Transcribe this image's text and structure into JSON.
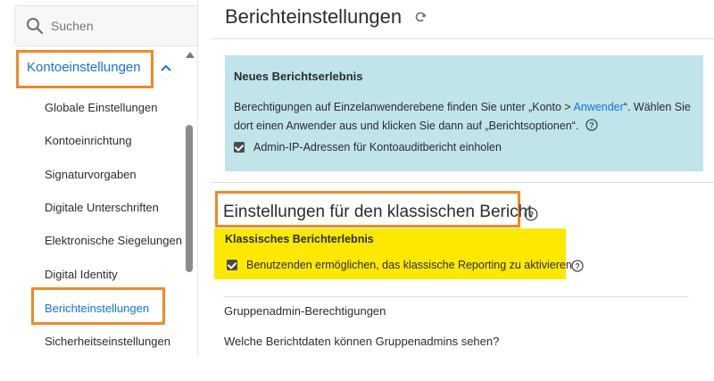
{
  "sidebar": {
    "search_placeholder": "Suchen",
    "group_label": "Kontoeinstellungen",
    "items": [
      {
        "label": "Globale Einstellungen"
      },
      {
        "label": "Kontoeinrichtung"
      },
      {
        "label": "Signaturvorgaben"
      },
      {
        "label": "Digitale Unterschriften"
      },
      {
        "label": "Elektronische Siegelungen"
      },
      {
        "label": "Digital Identity"
      },
      {
        "label": "Berichteinstellungen"
      },
      {
        "label": "Sicherheitseinstellungen"
      }
    ]
  },
  "main": {
    "title": "Berichteinstellungen",
    "info": {
      "title": "Neues Berichtserlebnis",
      "text_part1": "Berechtigungen auf Einzelanwenderebene finden Sie unter „Konto > ",
      "link": "Anwender",
      "text_part2": "“. Wählen Sie dort einen Anwender aus und klicken Sie dann auf „Berichtsoptionen“.",
      "checkbox_label": "Admin-IP-Adressen für Kontoauditbericht einholen"
    },
    "classic": {
      "title": "Einstellungen für den klassischen Bericht",
      "label": "Klassisches Berichterlebnis",
      "checkbox_label": "Benutzenden ermöglichen, das klassische Reporting zu aktivieren"
    },
    "group": {
      "heading": "Gruppenadmin-Berechtigungen",
      "question": "Welche Berichtdaten können Gruppenadmins sehen?"
    }
  },
  "colors": {
    "accent": "#1473e6",
    "highlight_border": "#f08a24",
    "info_bg": "#bfe4ea",
    "yellow_highlight": "#fde800"
  }
}
